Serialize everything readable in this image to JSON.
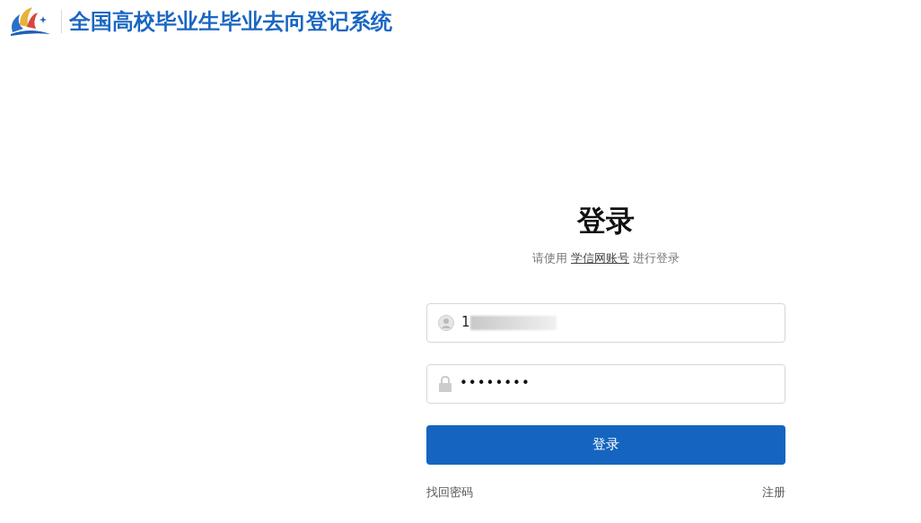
{
  "header": {
    "title": "全国高校毕业生毕业去向登记系统"
  },
  "login": {
    "title": "登录",
    "subtitle_before": "请使用",
    "subtitle_link": "学信网账号",
    "subtitle_after": "进行登录",
    "username": {
      "value": "1",
      "masked": true
    },
    "password": {
      "value": "••••••••"
    },
    "submit": "登录",
    "links": [
      "找回密码",
      "注册"
    ]
  }
}
